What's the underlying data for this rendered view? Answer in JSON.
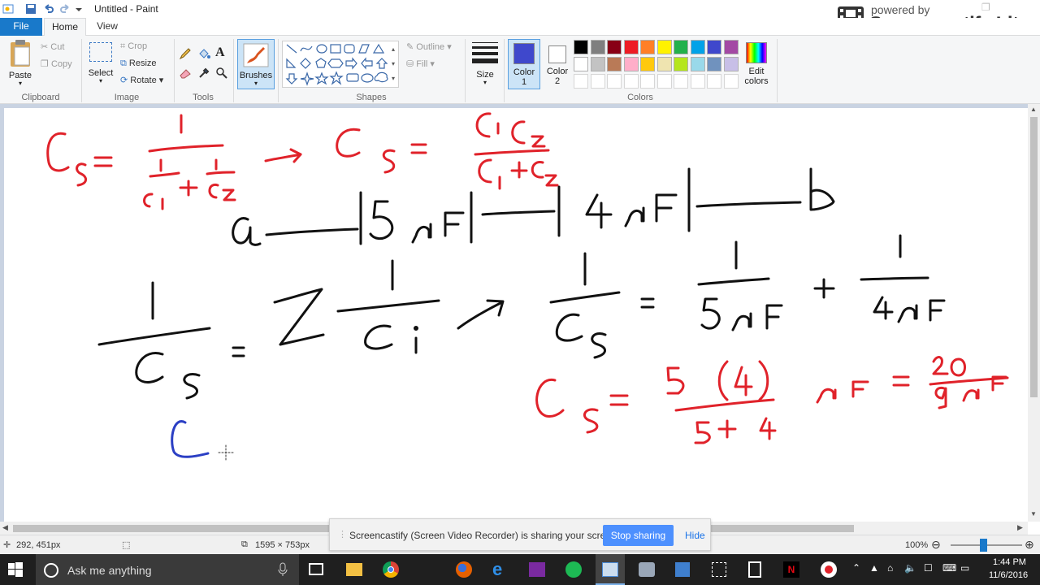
{
  "window": {
    "title": "Untitled - Paint"
  },
  "watermark": {
    "line1": "powered by",
    "line2": "Screencastify Lite"
  },
  "tabs": {
    "file": "File",
    "home": "Home",
    "view": "View"
  },
  "clipboard": {
    "paste": "Paste",
    "cut": "Cut",
    "copy": "Copy",
    "label": "Clipboard"
  },
  "image": {
    "select": "Select",
    "crop": "Crop",
    "resize": "Resize",
    "rotate": "Rotate",
    "label": "Image"
  },
  "tools": {
    "label": "Tools"
  },
  "brushes": {
    "label": "Brushes"
  },
  "shapes": {
    "outline": "Outline",
    "fill": "Fill",
    "label": "Shapes"
  },
  "size": {
    "label": "Size"
  },
  "colors": {
    "color1_label": "Color\n1",
    "color1_a": "Color",
    "color1_b": "1",
    "color2_a": "Color",
    "color2_b": "2",
    "edit_a": "Edit",
    "edit_b": "colors",
    "label": "Colors",
    "color1_value": "#3f48cc",
    "color2_value": "#ffffff",
    "palette_row1": [
      "#000000",
      "#7f7f7f",
      "#880015",
      "#ed1c24",
      "#ff7f27",
      "#fff200",
      "#22b14c",
      "#00a2e8",
      "#3f48cc",
      "#a349a4"
    ],
    "palette_row2": [
      "#ffffff",
      "#c3c3c3",
      "#b97a57",
      "#ffaec9",
      "#ffc90e",
      "#efe4b0",
      "#b5e61d",
      "#99d9ea",
      "#7092be",
      "#c8bfe7"
    ]
  },
  "status": {
    "cursor_pos": "292, 451px",
    "canvas_size": "1595 × 753px",
    "zoom": "100%"
  },
  "banner": {
    "message": "Screencastify (Screen Video Recorder) is sharing your screen.",
    "stop": "Stop sharing",
    "hide": "Hide"
  },
  "taskbar": {
    "search_placeholder": "Ask me anything",
    "time": "1:44 PM",
    "date": "11/6/2016"
  },
  "ink": {
    "red": "#e0222a",
    "black": "#111111",
    "blue": "#2b3fc4"
  }
}
